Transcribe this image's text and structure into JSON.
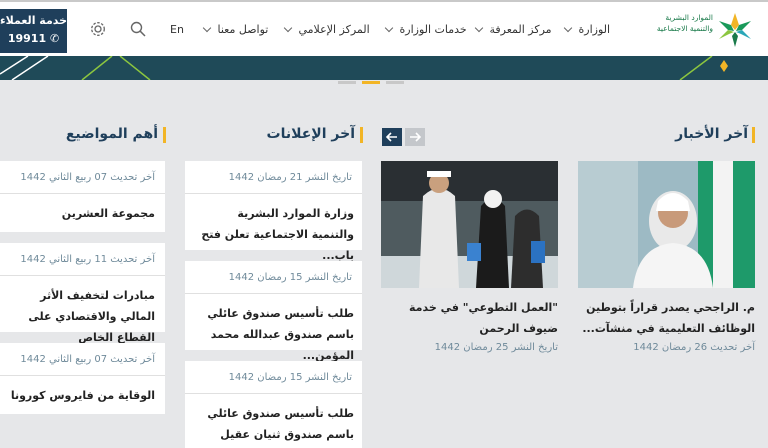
{
  "header": {
    "customer_service": {
      "title": "خدمة العملاء",
      "phone": "19911"
    },
    "lang": "En",
    "nav": [
      {
        "label": "الوزارة"
      },
      {
        "label": "مركز المعرفة"
      },
      {
        "label": "خدمات الوزارة"
      },
      {
        "label": "المركز الإعلامي"
      },
      {
        "label": "تواصل معنا"
      }
    ],
    "logo": {
      "line1": "الموارد البشرية",
      "line2": "والتنمية الاجتماعية"
    }
  },
  "sections": {
    "news": {
      "title": "آخر الأخبار",
      "items": [
        {
          "title": "م. الراجحي يصدر قراراً بتوطين الوظائف التعليمية في منشآت...",
          "date": "آخر تحديث 26 رمضان 1442"
        },
        {
          "title": "\"العمل التطوعي\" في خدمة ضيوف الرحمن",
          "date": "تاريخ النشر 25 رمضان 1442"
        }
      ]
    },
    "announcements": {
      "title": "آخر الإعلانات",
      "items": [
        {
          "date": "تاريخ النشر 21 رمضان 1442",
          "title": "وزارة الموارد البشرية والتنمية الاجتماعية تعلن فتح باب..."
        },
        {
          "date": "تاريخ النشر 15 رمضان 1442",
          "title": "طلب تأسيس صندوق عائلي باسم صندوق عبدالله محمد المؤمن..."
        },
        {
          "date": "تاريخ النشر 15 رمضان 1442",
          "title": "طلب تأسيس صندوق عائلي باسم صندوق ثنيان عقيل الرميح ومقره..."
        }
      ]
    },
    "topics": {
      "title": "أهم المواضيع",
      "items": [
        {
          "date": "آخر تحديث 07 ربيع الثاني 1442",
          "title": "مجموعة العشرين"
        },
        {
          "date": "آخر تحديث 11 ربيع الثاني 1442",
          "title": "مبادرات لتخفيف الأثر المالي والاقتصادي على القطاع الخاص"
        },
        {
          "date": "آخر تحديث 07 ربيع الثاني 1442",
          "title": "الوقاية من فايروس كورونا"
        }
      ]
    }
  },
  "colors": {
    "primary": "#1f3f5b",
    "accent": "#f2b526",
    "brand_green": "#1a7a4a"
  }
}
